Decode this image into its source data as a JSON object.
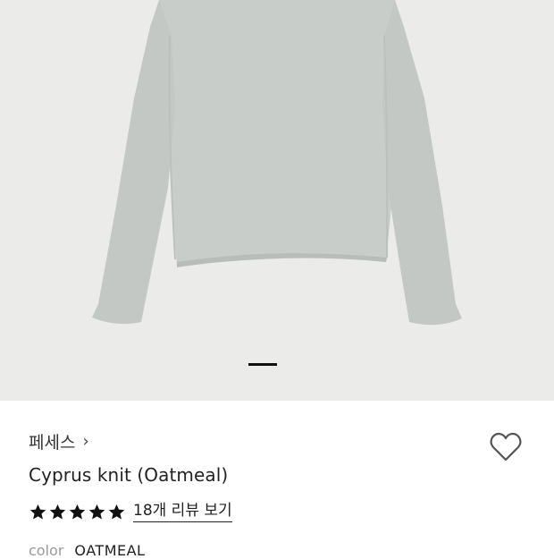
{
  "product_image": {
    "alt": "knit",
    "colors": {
      "background": "#ebebe9",
      "garment": "#c8cdc9",
      "garment_shade": "#b8bdb9"
    }
  },
  "carousel": {
    "active_index": 1,
    "total": 1
  },
  "product": {
    "brand": "페세스",
    "brand_chevron": "›",
    "name": "Cyprus knit (Oatmeal)",
    "rating": 5,
    "review_link": "18개 리뷰 보기",
    "option_label": "color",
    "option_value": "OATMEAL"
  },
  "icons": {
    "wishlist": "heart-outline-icon",
    "star": "star-filled-icon",
    "brand_chevron": "chevron-right-icon"
  }
}
